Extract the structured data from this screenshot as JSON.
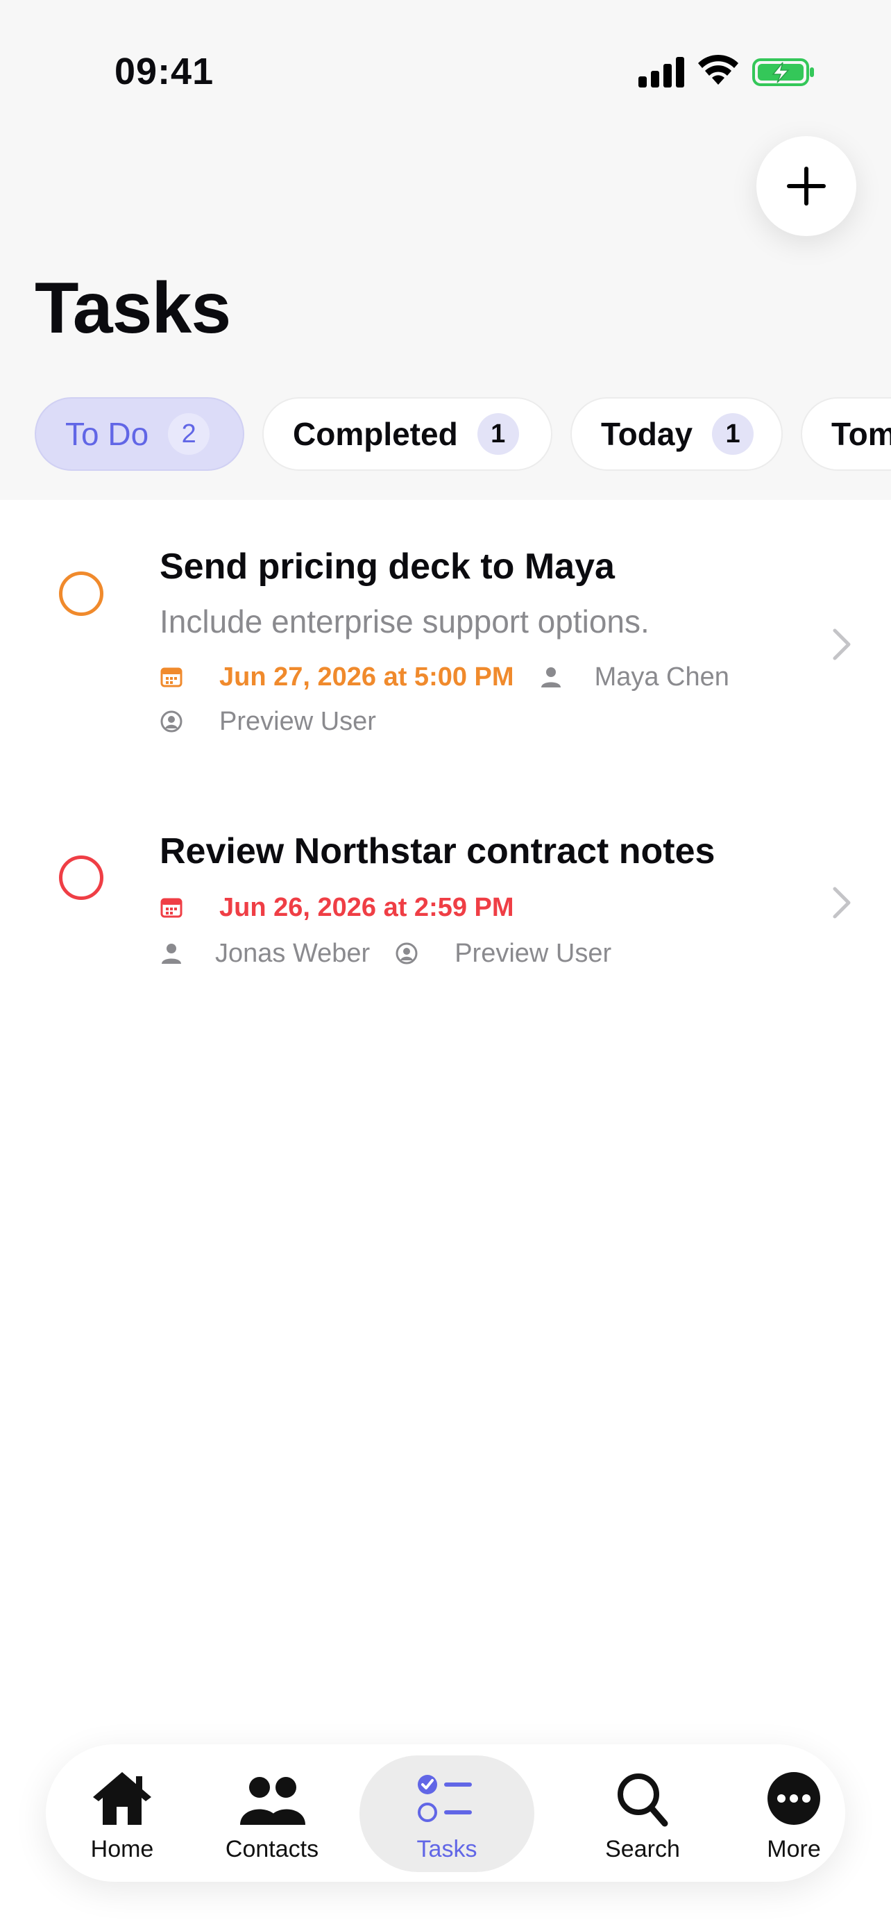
{
  "status": {
    "time": "09:41"
  },
  "page": {
    "title": "Tasks"
  },
  "filters": [
    {
      "label": "To Do",
      "count": "2",
      "active": true
    },
    {
      "label": "Completed",
      "count": "1",
      "active": false
    },
    {
      "label": "Today",
      "count": "1",
      "active": false
    },
    {
      "label": "Tomorrow",
      "count": "",
      "active": false
    }
  ],
  "tasks": [
    {
      "title": "Send pricing deck to Maya",
      "description": "Include enterprise support options.",
      "due": "Jun 27, 2026 at 5:00 PM",
      "contact": "Maya Chen",
      "owner": "Preview User",
      "status_color": "#f08a2c"
    },
    {
      "title": "Review Northstar contract notes",
      "due": "Jun 26, 2026 at 2:59 PM",
      "contact": "Jonas Weber",
      "owner": "Preview User",
      "status_color": "#ef3e45"
    }
  ],
  "tabbar": [
    {
      "label": "Home",
      "icon": "house-icon"
    },
    {
      "label": "Contacts",
      "icon": "people-icon"
    },
    {
      "label": "Tasks",
      "icon": "checklist-icon",
      "active": true
    },
    {
      "label": "Search",
      "icon": "magnifier-icon"
    },
    {
      "label": "More",
      "icon": "ellipsis-circle-icon"
    }
  ],
  "colors": {
    "accent": "#6166e6",
    "due_soon": "#f08a2c",
    "overdue": "#ef3e45"
  }
}
